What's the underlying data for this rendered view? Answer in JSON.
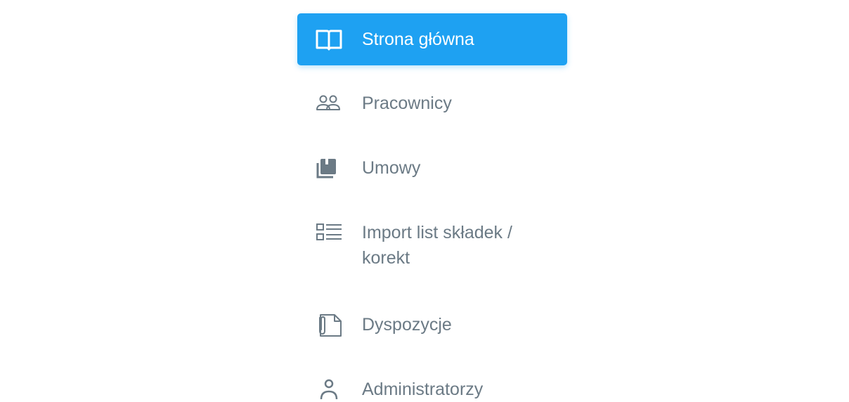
{
  "sidebar": {
    "items": [
      {
        "label": "Strona główna",
        "icon": "book-open-icon",
        "active": true
      },
      {
        "label": "Pracownicy",
        "icon": "users-icon",
        "active": false
      },
      {
        "label": "Umowy",
        "icon": "contracts-icon",
        "active": false
      },
      {
        "label": "Import list składek / korekt",
        "icon": "list-icon",
        "active": false
      },
      {
        "label": "Dyspozycje",
        "icon": "document-clip-icon",
        "active": false
      },
      {
        "label": "Administratorzy",
        "icon": "user-icon",
        "active": false
      }
    ]
  },
  "colors": {
    "accent": "#1ea1f2",
    "text": "#6b7a85",
    "active_text": "#ffffff"
  }
}
